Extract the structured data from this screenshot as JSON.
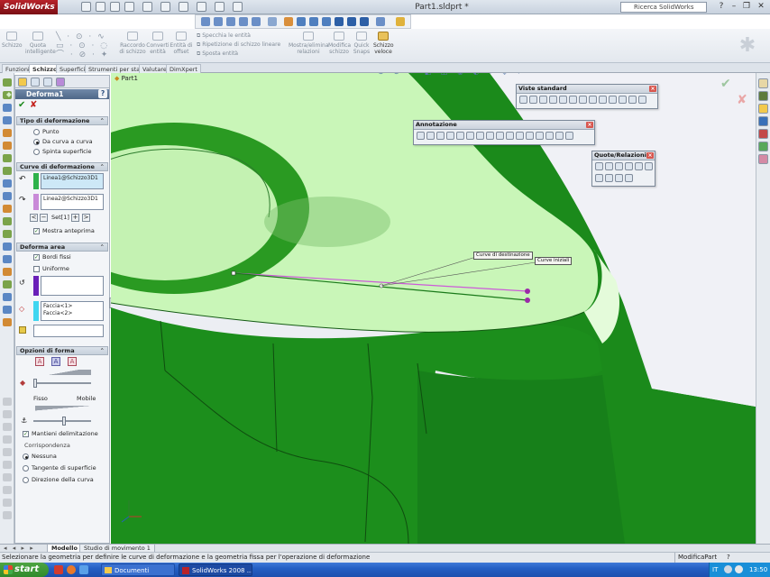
{
  "app": {
    "logo": "SolidWorks",
    "doc_title": "Part1.sldprt *"
  },
  "search": {
    "label": "Ricerca SolidWorks",
    "help_label": "?"
  },
  "command_manager": {
    "items": [
      "Schizzo",
      "Quota intelligente",
      "Raccordo di schizzo",
      "Converti entità",
      "Entità di offset",
      "Specchia le entità",
      "Ripetizione di schizzo lineare",
      "Sposta entità",
      "Mostra/elimina relazioni",
      "Modifica schizzo",
      "Quick Snaps",
      "Schizzo veloce"
    ]
  },
  "tabs": [
    "Funzioni",
    "Schizzo",
    "Superfici",
    "Strumenti per stampi",
    "Valutare",
    "DimXpert"
  ],
  "tree": {
    "root": "Part1"
  },
  "property_manager": {
    "title": "Deforma1",
    "help": "?",
    "ok": "✔",
    "cancel": "✘",
    "sections": {
      "tipo": {
        "title": "Tipo di deformazione",
        "options": [
          "Punto",
          "Da curva a curva",
          "Spinta superficie"
        ],
        "selected": 1
      },
      "curve": {
        "title": "Curve di deformazione",
        "initial": "Linea1@Schizzo3D1",
        "target": "Linea2@Schizzo3D1",
        "set_label": "Set[1]",
        "preview_label": "Mostra anteprima"
      },
      "area": {
        "title": "Deforma area",
        "fixed_edges": "Bordi fissi",
        "uniform": "Uniforme",
        "faces": [
          "Faccia<1>",
          "Faccia<2>"
        ]
      },
      "forma": {
        "title": "Opzioni di forma",
        "fixed": "Fisso",
        "mobile": "Mobile",
        "keep": "Mantieni delimitazione",
        "match_title": "Corrispondenza",
        "match": [
          "Nessuna",
          "Tangente di superficie",
          "Direzione della curva"
        ],
        "match_selected": 0
      }
    }
  },
  "toolbars": {
    "viste": {
      "title": "Viste standard"
    },
    "annotazione": {
      "title": "Annotazione"
    },
    "quote": {
      "title": "Quote/Relazioni"
    }
  },
  "callouts": {
    "destination": "Curve di destinazione",
    "initial": "Curve iniziali"
  },
  "bottom_tabs": [
    "Modello",
    "Studio di movimento 1"
  ],
  "status": {
    "message": "Selezionare la geometria per definire le curve di deformazione e la geometria fissa per l'operazione di deformazione",
    "mode": "ModificaPart",
    "help": "?"
  },
  "taskbar": {
    "start": "start",
    "items": [
      "Documenti",
      "SolidWorks 2008 ..."
    ],
    "lang": "IT",
    "clock": "13:50"
  },
  "colors": {
    "part_green": "#1d8c1d",
    "face_highlight": "#c8f5b8",
    "accent_red": "#b8232a"
  }
}
